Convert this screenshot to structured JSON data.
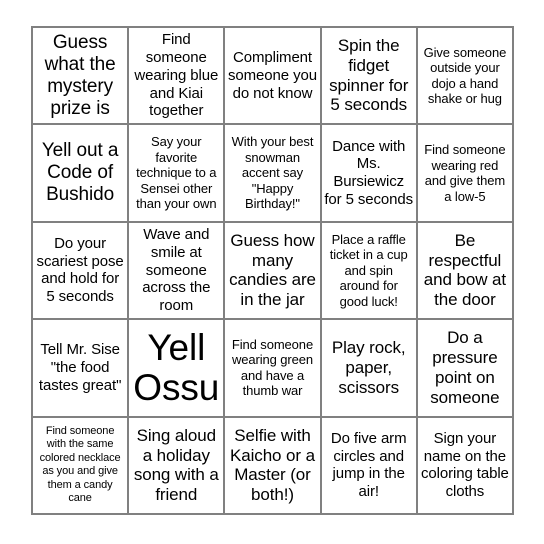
{
  "card": {
    "type": "bingo-card",
    "rows": 5,
    "columns": 5,
    "border_color": "#808080",
    "background_color": "#ffffff",
    "text_color": "#000000",
    "cells": [
      {
        "id": "r1c1",
        "text": "Guess what the mystery prize is",
        "size": "fs-xl"
      },
      {
        "id": "r1c2",
        "text": "Find someone wearing blue and Kiai together",
        "size": "fs-md"
      },
      {
        "id": "r1c3",
        "text": "Compliment someone you do not know",
        "size": "fs-md"
      },
      {
        "id": "r1c4",
        "text": "Spin the fidget spinner for 5 seconds",
        "size": "fs-lg"
      },
      {
        "id": "r1c5",
        "text": "Give someone outside your dojo a hand shake or hug",
        "size": "fs-sm"
      },
      {
        "id": "r2c1",
        "text": "Yell out a Code of Bushido",
        "size": "fs-xl"
      },
      {
        "id": "r2c2",
        "text": "Say your favorite technique to a Sensei other than your own",
        "size": "fs-sm"
      },
      {
        "id": "r2c3",
        "text": "With your best snowman accent say \"Happy Birthday!\"",
        "size": "fs-sm"
      },
      {
        "id": "r2c4",
        "text": "Dance with Ms. Bursiewicz for 5 seconds",
        "size": "fs-md"
      },
      {
        "id": "r2c5",
        "text": "Find someone wearing red and give them a low-5",
        "size": "fs-sm"
      },
      {
        "id": "r3c1",
        "text": "Do your scariest pose and hold for 5 seconds",
        "size": "fs-md"
      },
      {
        "id": "r3c2",
        "text": "Wave and smile at someone across the room",
        "size": "fs-md"
      },
      {
        "id": "r3c3",
        "text": "Guess how many candies are in the jar",
        "size": "fs-lg"
      },
      {
        "id": "r3c4",
        "text": "Place a raffle ticket in a cup and spin around for good luck!",
        "size": "fs-sm"
      },
      {
        "id": "r3c5",
        "text": "Be respectful and bow at the door",
        "size": "fs-lg"
      },
      {
        "id": "r4c1",
        "text": "Tell Mr. Sise \"the food tastes great\"",
        "size": "fs-md"
      },
      {
        "id": "r4c2",
        "text": "Yell Ossu",
        "size": "fs-free"
      },
      {
        "id": "r4c3",
        "text": "Find someone wearing green and have a thumb war",
        "size": "fs-sm"
      },
      {
        "id": "r4c4",
        "text": "Play rock, paper, scissors",
        "size": "fs-lg"
      },
      {
        "id": "r4c5",
        "text": "Do a pressure point on someone",
        "size": "fs-lg"
      },
      {
        "id": "r5c1",
        "text": "Find someone with the same colored necklace as you and give them a candy cane",
        "size": "fs-xs"
      },
      {
        "id": "r5c2",
        "text": "Sing aloud a holiday song with a friend",
        "size": "fs-lg"
      },
      {
        "id": "r5c3",
        "text": "Selfie with Kaicho or a Master (or both!)",
        "size": "fs-lg"
      },
      {
        "id": "r5c4",
        "text": "Do five arm circles and jump in the air!",
        "size": "fs-md"
      },
      {
        "id": "r5c5",
        "text": "Sign your name on the coloring table cloths",
        "size": "fs-md"
      }
    ]
  }
}
